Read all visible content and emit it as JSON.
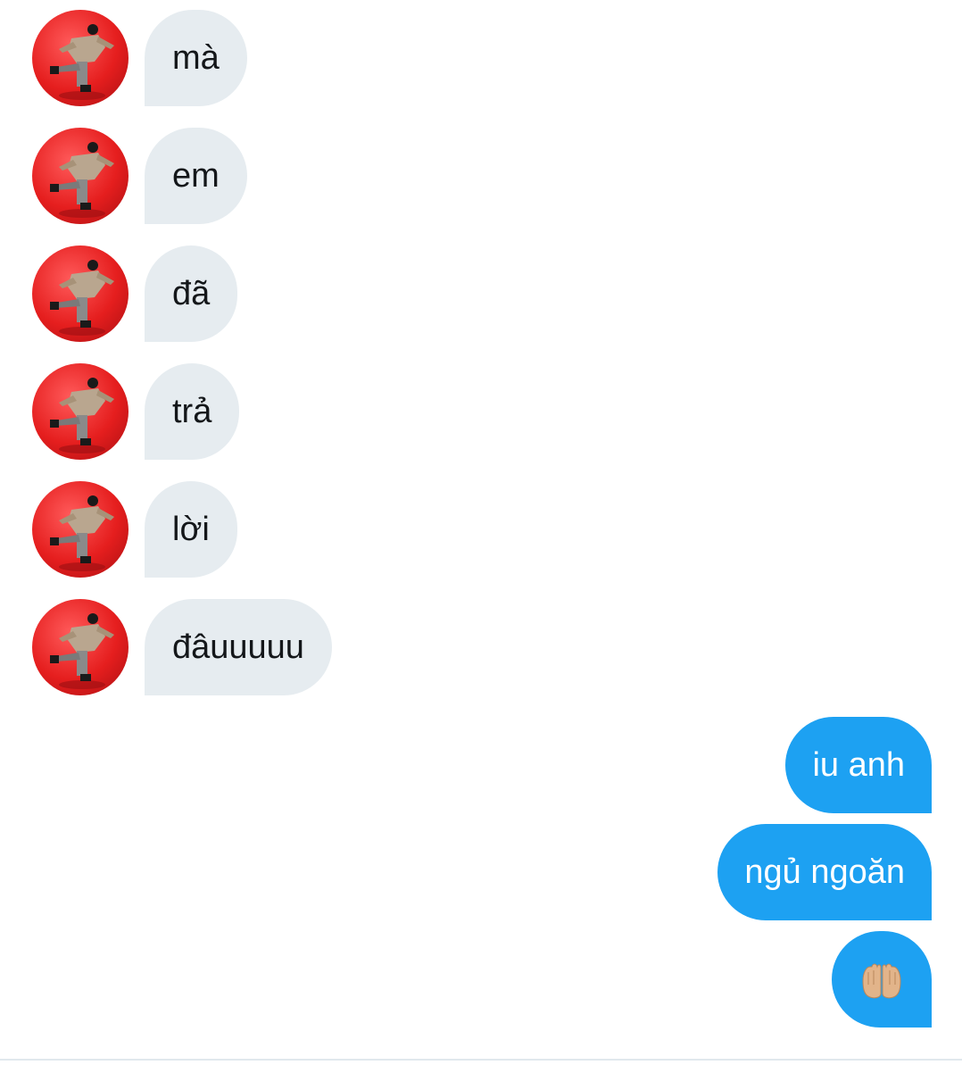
{
  "thread": {
    "incoming": [
      {
        "text": "mà"
      },
      {
        "text": "em"
      },
      {
        "text": "đã"
      },
      {
        "text": "trả"
      },
      {
        "text": "lời"
      },
      {
        "text": "đâuuuuu"
      }
    ],
    "outgoing": [
      {
        "text": "iu anh"
      },
      {
        "text": "ngủ ngoăn"
      },
      {
        "icon": "palms-up-together-emoji"
      }
    ]
  },
  "colors": {
    "incoming_bubble": "#e6ecf0",
    "outgoing_bubble": "#1da1f2",
    "incoming_text": "#14171a",
    "outgoing_text": "#ffffff",
    "avatar_background": "#e51e1e"
  }
}
